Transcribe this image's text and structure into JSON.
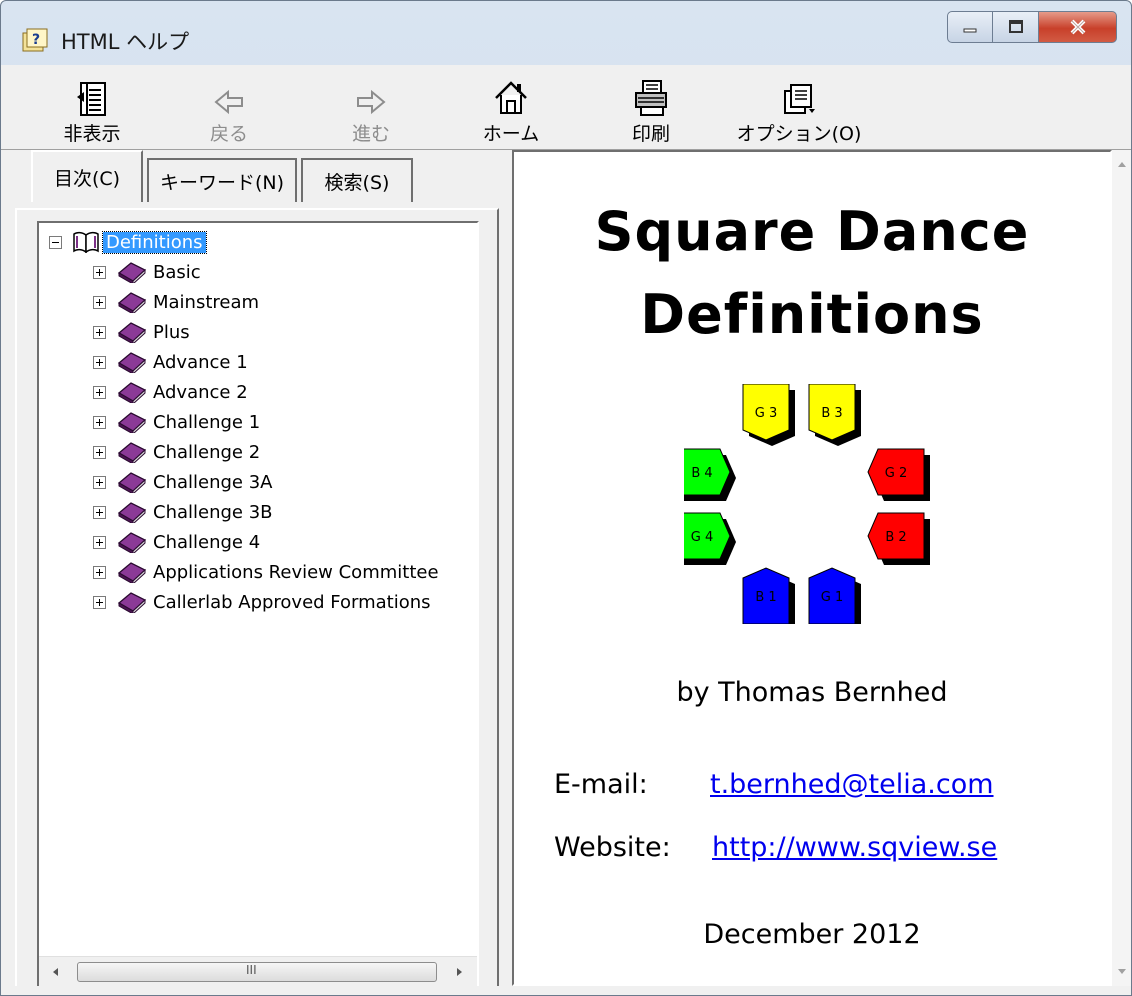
{
  "window": {
    "title": "HTML ヘルプ",
    "colors": {
      "close_button": "#c8402a",
      "selection": "#3399ff",
      "link": "#0000ee"
    }
  },
  "toolbar": {
    "hide_label": "非表示",
    "back_label": "戻る",
    "forward_label": "進む",
    "home_label": "ホーム",
    "print_label": "印刷",
    "options_label": "オプション(O)"
  },
  "tabs": {
    "contents": "目次(C)",
    "keyword": "キーワード(N)",
    "search": "検索(S)"
  },
  "tree": {
    "root": "Definitions",
    "items": [
      "Basic",
      "Mainstream",
      "Plus",
      "Advance 1",
      "Advance 2",
      "Challenge 1",
      "Challenge 2",
      "Challenge 3A",
      "Challenge 3B",
      "Challenge 4",
      "Applications Review Committee",
      "Callerlab Approved Formations"
    ],
    "scroll_thumb_grip": "III"
  },
  "content": {
    "title_line1": "Square Dance",
    "title_line2": "Definitions",
    "dancers": [
      {
        "label": "G 3",
        "color": "#ffff00"
      },
      {
        "label": "B 3",
        "color": "#ffff00"
      },
      {
        "label": "G 2",
        "color": "#ff0000"
      },
      {
        "label": "B 2",
        "color": "#ff0000"
      },
      {
        "label": "G 1",
        "color": "#0000ff"
      },
      {
        "label": "B 1",
        "color": "#0000ff"
      },
      {
        "label": "G 4",
        "color": "#00ff00"
      },
      {
        "label": "B 4",
        "color": "#00ff00"
      }
    ],
    "byline": "by Thomas Bernhed",
    "email_label": "E-mail:",
    "email_link": "t.bernhed@telia.com",
    "website_label": "Website:",
    "website_link": "http://www.sqview.se",
    "date": "December 2012"
  }
}
